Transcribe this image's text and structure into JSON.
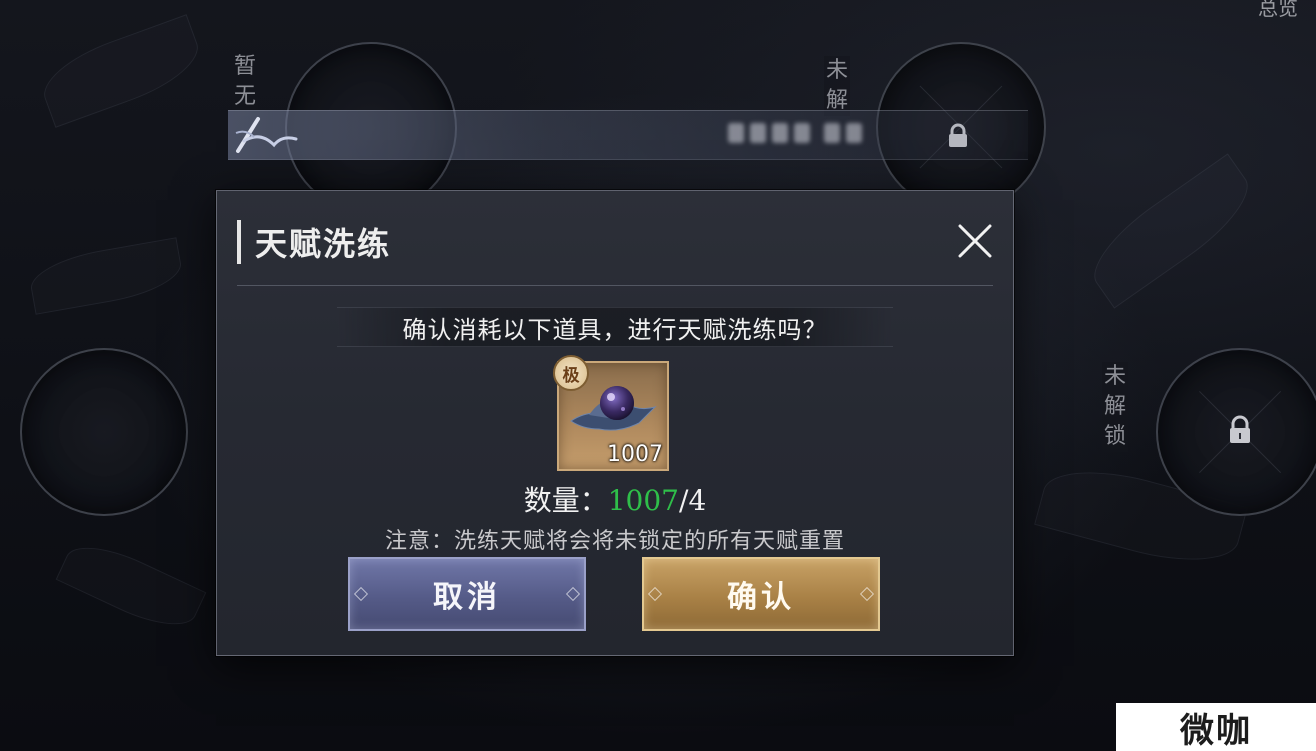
{
  "background": {
    "labels": {
      "top_left": "暂无",
      "top_right_ring": "未解",
      "right_ring": "未解锁",
      "corner": "总览"
    }
  },
  "dialog": {
    "title": "天赋洗练",
    "prompt": "确认消耗以下道具，进行天赋洗练吗？",
    "item": {
      "grade_badge": "极",
      "count": "1007",
      "icon": "talent-orb-icon"
    },
    "quantity": {
      "label": "数量：",
      "owned": "1007",
      "separator": "/",
      "required": "4"
    },
    "note": "注意：洗练天赋将会将未锁定的所有天赋重置",
    "cancel_label": "取消",
    "confirm_label": "确认"
  },
  "watermark": "微咖",
  "colors": {
    "owned_quantity": "#2fbf4a",
    "cancel_button": "#555b88",
    "confirm_button": "#a98146"
  }
}
